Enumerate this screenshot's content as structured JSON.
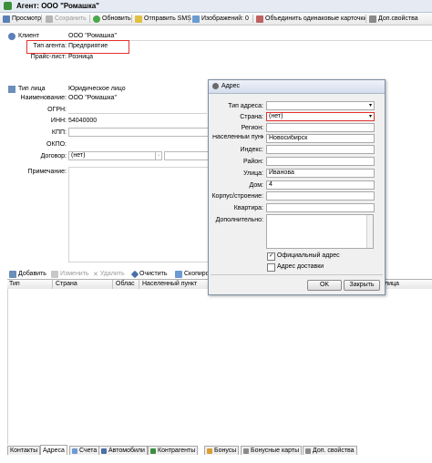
{
  "window": {
    "title": "Агент: ООО \"Ромашка\""
  },
  "toolbar": {
    "view": "Просмотр",
    "save": "Сохранить",
    "refresh": "Обновить",
    "send_sms": "Отправить SMS",
    "images": "Изображений: 0",
    "merge": "Объединить одинаковые карточки",
    "extra_props": "Доп.свойства"
  },
  "client": {
    "section_label": "Клиент",
    "name": "ООО \"Ромашка\"",
    "agent_type_label": "Тип агента:",
    "agent_type_value": "Предприятие",
    "price_list_label": "Прайс-лист:",
    "price_list_value": "Розница"
  },
  "person": {
    "section_label": "Тип лица",
    "type_value": "Юридическое лицо",
    "name_label": "Наименование:",
    "name_value": "ООО \"Ромашка\"",
    "ogrn_label": "ОГРН:",
    "inn_label": "ИНН:",
    "inn_value": "54040000",
    "kpp_label": "КПП:",
    "okpo_label": "ОКПО:",
    "contract_label": "Договор:",
    "contract_value": "(нет)",
    "note_label": "Примечание:"
  },
  "grid": {
    "add": "Добавить",
    "edit": "Изменить",
    "delete": "Удалить",
    "clear": "Очистить",
    "copy": "Скопиро",
    "columns": [
      "Тип",
      "Страна",
      "Облас",
      "Населенный пункт",
      "лица"
    ]
  },
  "tabs": [
    "Контакты",
    "Адреса",
    "Счета",
    "Автомобили",
    "Контрагенты",
    "Бонусы",
    "Бонусные карты",
    "Доп. свойства"
  ],
  "address_dialog": {
    "title": "Адрес",
    "address_type_label": "Тип адреса:",
    "country_label": "Страна:",
    "country_value": "(нет)",
    "region_label": "Регион:",
    "locality_label": "Населенный пункт",
    "locality_value": "Новосибирск",
    "index_label": "Индекс:",
    "district_label": "Район:",
    "street_label": "Улица:",
    "street_value": "Иванова",
    "house_label": "Дом:",
    "house_value": "4",
    "building_label": "Корпус/строение:",
    "apartment_label": "Квартира:",
    "extra_label": "Дополнительно:",
    "official_label": "Официальный адрес",
    "official_checked": true,
    "delivery_label": "Адрес доставки",
    "delivery_checked": false,
    "ok": "OK",
    "close": "Закрыть"
  },
  "colors": {
    "highlight": "#e53030",
    "accent": "#3b8f3b"
  }
}
